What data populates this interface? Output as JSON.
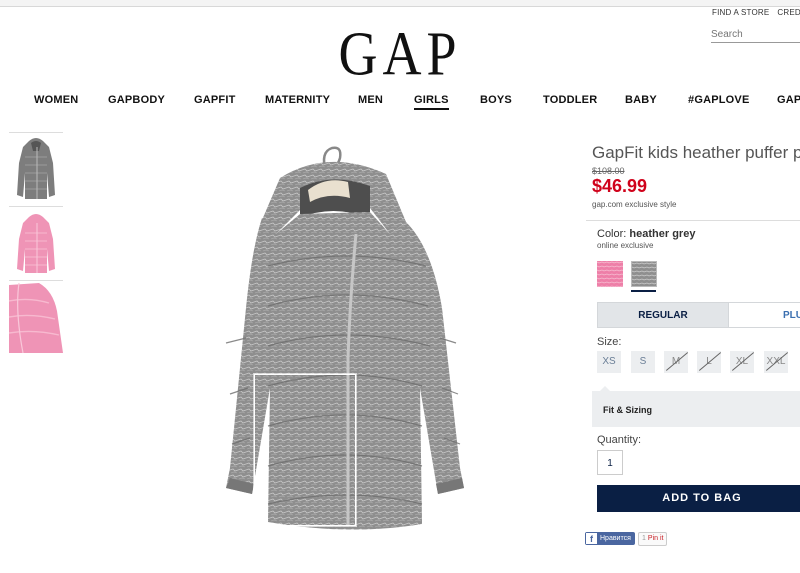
{
  "header": {
    "util_links": [
      "FIND A STORE",
      "CREDIT"
    ],
    "search_placeholder": "Search",
    "logo": "GAP"
  },
  "nav": {
    "items": [
      "WOMEN",
      "GAPBODY",
      "GAPFIT",
      "MATERNITY",
      "MEN",
      "GIRLS",
      "BOYS",
      "TODDLER",
      "BABY",
      "#GAPLOVE",
      "GAP"
    ],
    "active": "GIRLS"
  },
  "gallery": {
    "thumbnails": [
      "grey-coat-thumbnail",
      "pink-coat-thumbnail",
      "pink-coat-detail-thumbnail"
    ],
    "main_image": "heather-grey-puffer-parka"
  },
  "product": {
    "title": "GapFit kids heather puffer parka",
    "original_price": "$108.00",
    "sale_price": "$46.99",
    "exclusive_note": "gap.com exclusive style",
    "color_prefix": "Color:",
    "color_name": "heather grey",
    "online_note": "online exclusive",
    "swatches": [
      {
        "name": "pink",
        "color": "#ef8fb3"
      },
      {
        "name": "heather grey",
        "color": "#9a9a9a"
      }
    ],
    "fit_tabs": [
      "REGULAR",
      "PLUS"
    ],
    "size_label": "Size:",
    "sizes": [
      {
        "label": "XS",
        "available": true
      },
      {
        "label": "S",
        "available": true
      },
      {
        "label": "M",
        "available": false
      },
      {
        "label": "L",
        "available": false
      },
      {
        "label": "XL",
        "available": false
      },
      {
        "label": "XXL",
        "available": false
      }
    ],
    "fit_sizing": "Fit & Sizing",
    "quantity_label": "Quantity:",
    "quantity": "1",
    "add_to_bag": "ADD TO BAG"
  },
  "social": {
    "facebook": "Нравится",
    "pinterest_count": "1",
    "pinterest": "Pin it"
  },
  "colors": {
    "navy": "#0a1f44",
    "sale_red": "#d0021b",
    "facebook": "#4a66a0"
  }
}
